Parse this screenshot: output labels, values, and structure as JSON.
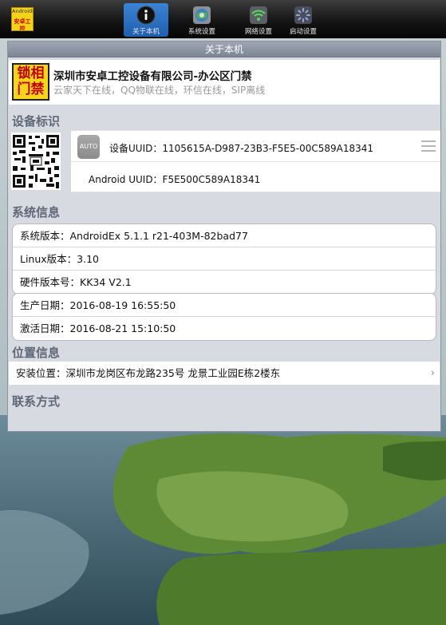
{
  "app": {
    "logo_line1": "AndroidEx",
    "logo_line2": "安卓工控"
  },
  "toolbar": {
    "tabs": [
      {
        "label": "关于本机",
        "icon": "info-icon",
        "active": true
      },
      {
        "label": "系统设置",
        "icon": "system-settings-icon",
        "active": false
      },
      {
        "label": "网络设置",
        "icon": "wifi-icon",
        "active": false
      },
      {
        "label": "启动设置",
        "icon": "startup-icon",
        "active": false
      }
    ]
  },
  "panel": {
    "title": "关于本机"
  },
  "company": {
    "logo_text_1": "锁相",
    "logo_text_2": "门禁",
    "name": "深圳市安卓工控设备有限公司-办公区门禁",
    "subtitle": "云家天下在线，QQ物联在线，环信在线，SIP离线"
  },
  "identity": {
    "section_title": "设备标识",
    "auto_label": "AUTO",
    "device_uuid": "设备UUID：1105615A-D987-23B3-F5E5-00C589A18341",
    "android_uuid": "Android UUID：F5E500C589A18341"
  },
  "system": {
    "section_title": "系统信息",
    "rows": [
      "系统版本：AndroidEx 5.1.1 r21-403M-82bad77",
      "Linux版本：3.10",
      "硬件版本号：KK34 V2.1"
    ],
    "dates": [
      "生产日期：2016-08-19 16:55:50",
      "激活日期：2016-08-21 15:10:50"
    ]
  },
  "location": {
    "section_title": "位置信息",
    "install": "安装位置：深圳市龙岗区布龙路235号 龙景工业园E栋2楼东"
  },
  "contact": {
    "section_title": "联系方式"
  },
  "colors": {
    "toolbar_active": "#2a6fc0",
    "panel_bg": "#d7dae1",
    "section_title": "#5f6878",
    "logo_yellow": "#f6d51b",
    "logo_red": "#c30000"
  }
}
